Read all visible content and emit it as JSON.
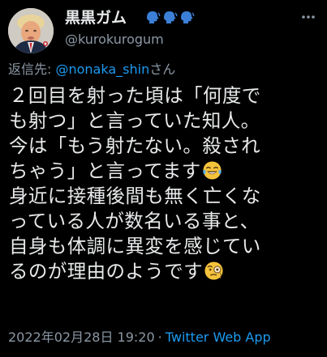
{
  "author": {
    "display_name": "黒黒ガム",
    "handle": "@kurokurogum",
    "badge_icons": [
      "speaking-head-icon",
      "speaking-head-icon",
      "speaking-head-icon"
    ]
  },
  "reply": {
    "prefix": "返信先: ",
    "mention": "@nonaka_shin",
    "suffix": "さん"
  },
  "tweet": {
    "lines": [
      "２回目を射った頃は「何度で",
      "も射つ」と言っていた知人。",
      "今は「もう射たない。殺され",
      "ちゃう」と言ってます",
      "身近に接種後間も無く亡くな",
      "っている人が数名いる事と、",
      "自身も体調に異変を感じてい",
      "るのが理由のようです"
    ],
    "emojis": [
      "face-with-tears-of-joy-icon",
      "face-with-monocle-icon"
    ]
  },
  "meta": {
    "timestamp": "2022年02月28日 19:20",
    "separator": "·",
    "source": "Twitter Web App"
  },
  "colors": {
    "background": "#000000",
    "text": "#e7e9ea",
    "secondary": "#8b98a5",
    "link": "#1d9bf0",
    "badge": "#3b7fd6"
  }
}
